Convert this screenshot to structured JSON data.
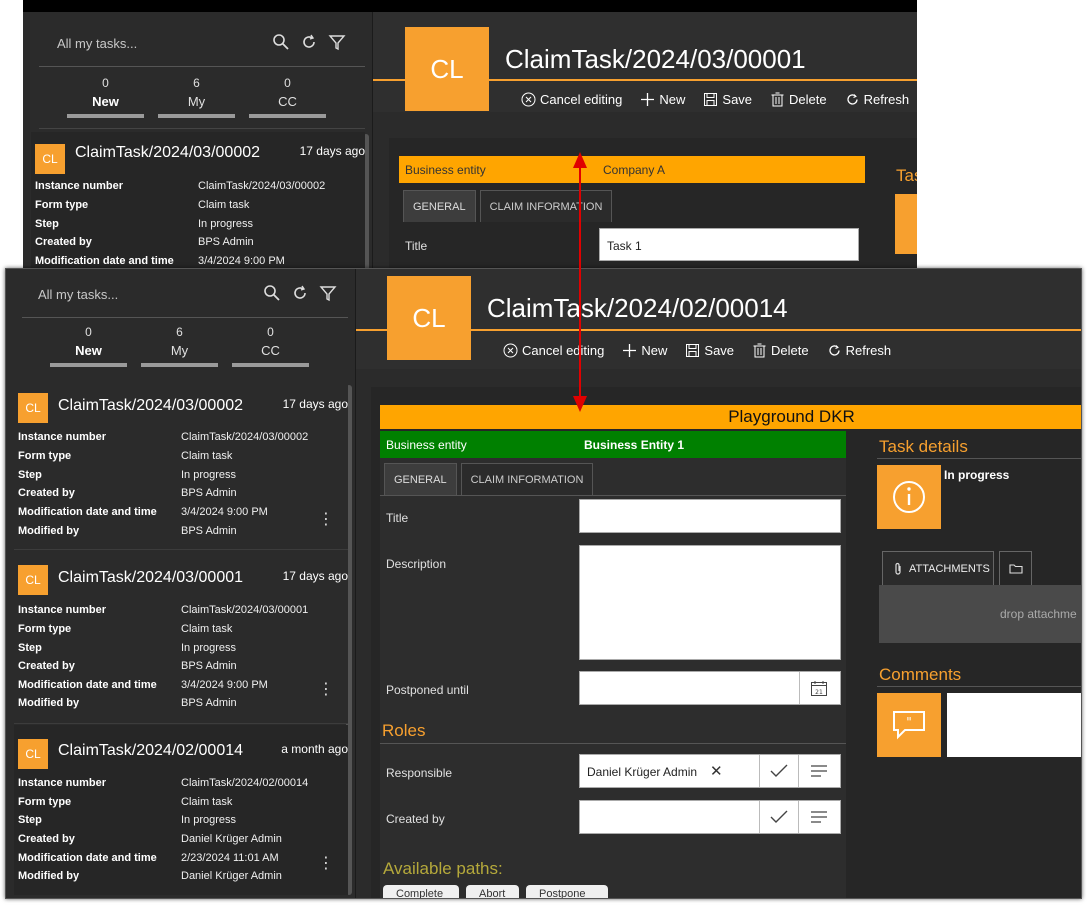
{
  "sidebar": {
    "search_placeholder": "All my tasks...",
    "counters": [
      {
        "num": "0",
        "label": "New"
      },
      {
        "num": "6",
        "label": "My"
      },
      {
        "num": "0",
        "label": "CC"
      }
    ],
    "fields": [
      "Instance number",
      "Form type",
      "Step",
      "Created by",
      "Modification date and time",
      "Modified by"
    ],
    "cards": [
      {
        "badge": "CL",
        "title": "ClaimTask/2024/03/00002",
        "age": "17 days ago",
        "values": [
          "ClaimTask/2024/03/00002",
          "Claim task",
          "In progress",
          "BPS Admin",
          "3/4/2024 9:00 PM",
          "BPS Admin"
        ]
      },
      {
        "badge": "CL",
        "title": "ClaimTask/2024/03/00001",
        "age": "17 days ago",
        "values": [
          "ClaimTask/2024/03/00001",
          "Claim task",
          "In progress",
          "BPS Admin",
          "3/4/2024 9:00 PM",
          "BPS Admin"
        ]
      },
      {
        "badge": "CL",
        "title": "ClaimTask/2024/02/00014",
        "age": "a month ago",
        "values": [
          "ClaimTask/2024/02/00014",
          "Claim task",
          "In progress",
          "Daniel Krüger Admin",
          "2/23/2024 11:01 AM",
          "Daniel Krüger Admin"
        ]
      }
    ]
  },
  "back": {
    "badge": "CL",
    "title": "ClaimTask/2024/03/00001",
    "business_entity_label": "Business entity",
    "business_entity_value": "Company A",
    "title_value": "Task 1",
    "side_title": "Tas"
  },
  "front": {
    "badge": "CL",
    "title": "ClaimTask/2024/02/00014",
    "playground": "Playground DKR",
    "business_entity_label": "Business entity",
    "business_entity_value": "Business Entity 1",
    "tabs": [
      "GENERAL",
      "CLAIM INFORMATION"
    ],
    "labels": {
      "title": "Title",
      "description": "Description",
      "postponed": "Postponed until",
      "responsible": "Responsible",
      "created_by": "Created by"
    },
    "roles_title": "Roles",
    "responsible_value": "Daniel Krüger Admin",
    "available_paths": "Available paths:",
    "path_buttons": [
      "Complete",
      "Abort",
      "Postpone"
    ],
    "task_details": "Task details",
    "task_status": "In progress",
    "attachments_tab": "ATTACHMENTS",
    "drop_text": "drop attachme",
    "comments_title": "Comments",
    "calendar_day": "21"
  },
  "toolbar": {
    "cancel": "Cancel editing",
    "new": "New",
    "save": "Save",
    "delete": "Delete",
    "refresh": "Refresh"
  },
  "colors": {
    "accent": "#f7a02f",
    "playground": "#ffa500",
    "business_entity_green": "#008000",
    "arrow": "#e00000"
  }
}
